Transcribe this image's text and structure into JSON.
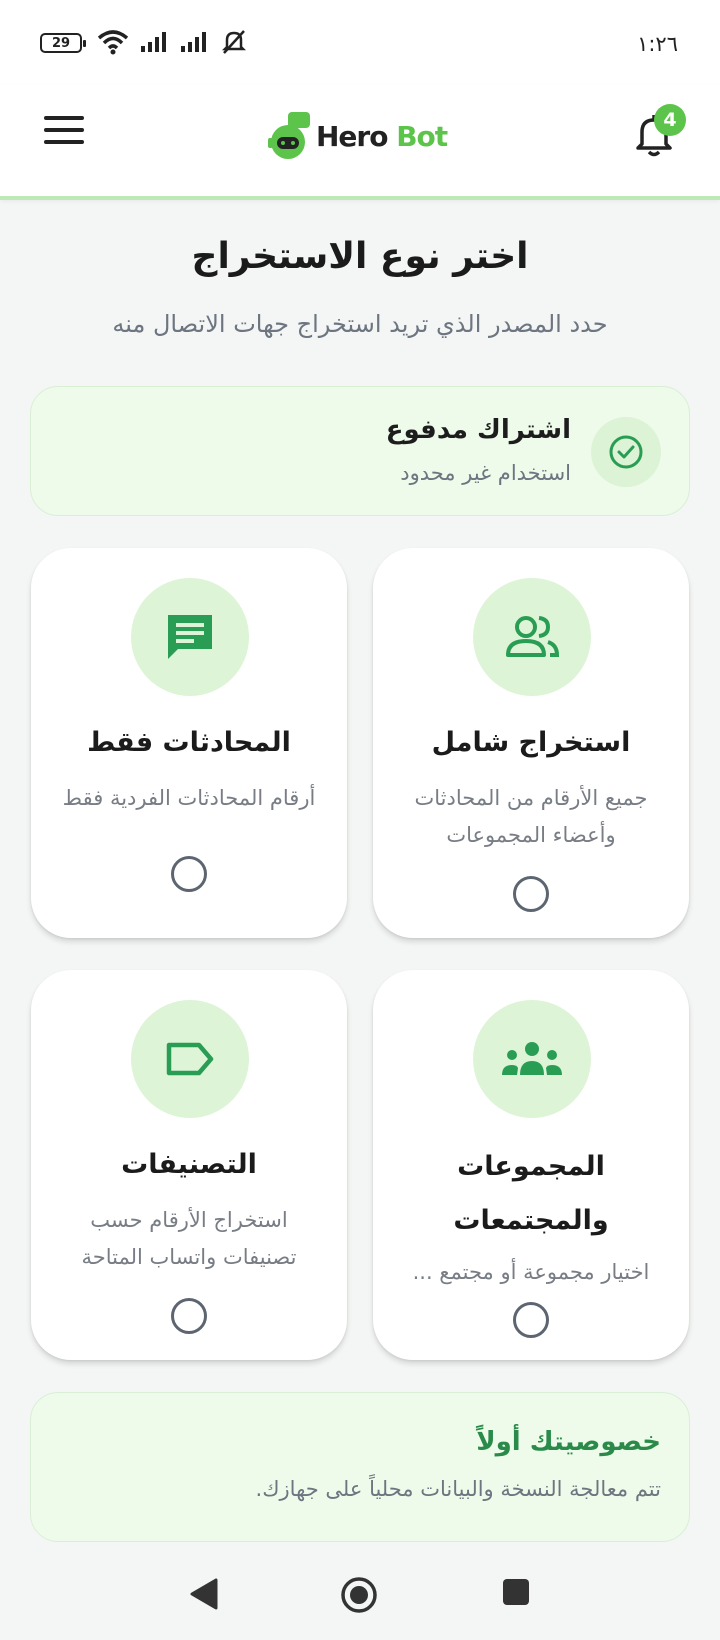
{
  "status_bar": {
    "time": "١:٢٦",
    "battery": "29",
    "icons": [
      "wifi-icon",
      "signal-icon",
      "signal-icon",
      "bell-off-icon"
    ]
  },
  "header": {
    "logo_hero": "Hero",
    "logo_bot": "Bot",
    "notification_count": "4",
    "accent_color": "#5cc44a"
  },
  "page": {
    "title": "اختر نوع الاستخراج",
    "subtitle": "حدد المصدر الذي تريد استخراج جهات الاتصال منه"
  },
  "subscription": {
    "title": "اشتراك مدفوع",
    "description": "استخدام غير محدود",
    "icon": "check-circle-icon"
  },
  "options": [
    {
      "title": "استخراج شامل",
      "description": "جميع الأرقام من المحادثات وأعضاء المجموعات",
      "icon": "users-icon",
      "selected": false
    },
    {
      "title": "المحادثات فقط",
      "description": "أرقام المحادثات الفردية فقط",
      "icon": "chat-icon",
      "selected": false
    },
    {
      "title": "المجموعات والمجتمعات",
      "description": "اختيار مجموعة أو مجتمع ...",
      "icon": "groups-icon",
      "selected": false
    },
    {
      "title": "التصنيفات",
      "description": "استخراج الأرقام حسب تصنيفات واتساب المتاحة",
      "icon": "label-icon",
      "selected": false
    }
  ],
  "privacy": {
    "title": "خصوصيتك أولاً",
    "description": "تتم معالجة النسخة والبيانات محلياً على جهازك."
  },
  "colors": {
    "primary_green": "#2a9d55",
    "light_green": "#ddf4d7",
    "background": "#f4f6f5"
  }
}
